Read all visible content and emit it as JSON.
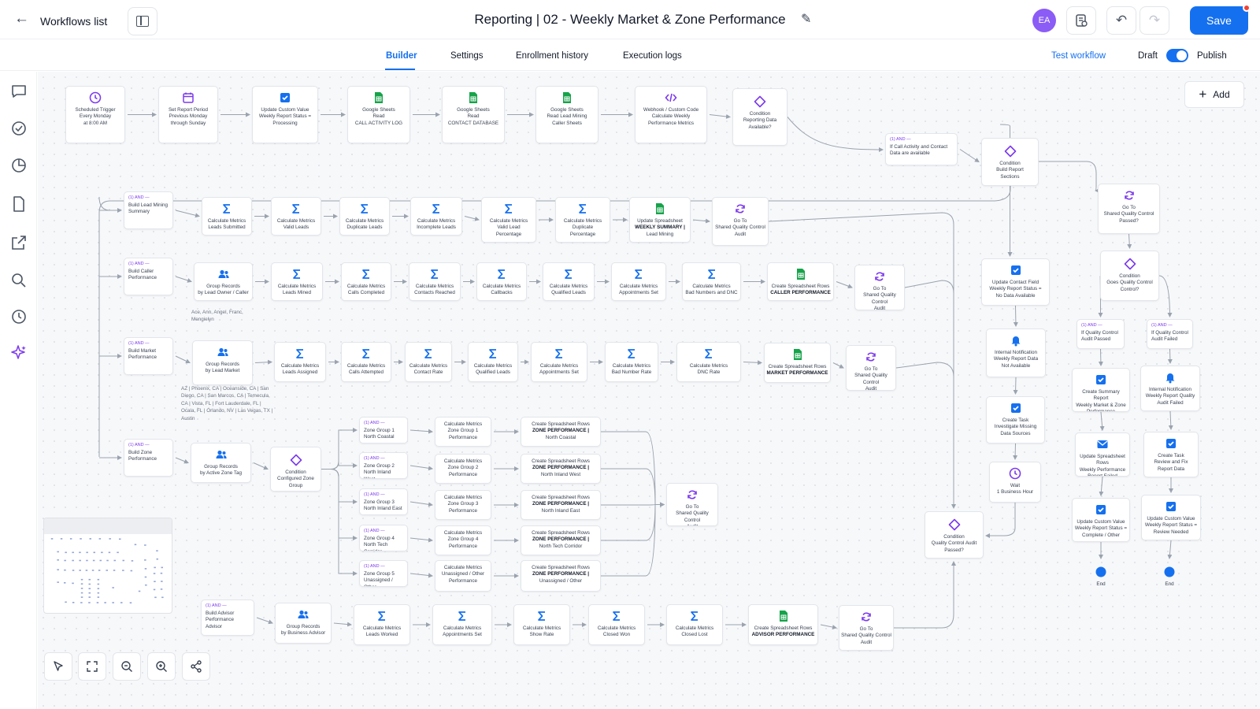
{
  "header": {
    "back_label": "Workflows list",
    "title": "Reporting | 02 - Weekly Market & Zone Performance",
    "avatar": "EA",
    "save_label": "Save"
  },
  "tabs": {
    "items": [
      "Builder",
      "Settings",
      "Enrollment history",
      "Execution logs"
    ],
    "active": "Builder",
    "test_label": "Test workflow",
    "draft_label": "Draft",
    "publish_label": "Publish",
    "published": true
  },
  "toolbar": {
    "add_label": "Add"
  },
  "colors": {
    "accent": "#1570ef",
    "sheets": "#16a34a",
    "condition": "#7c3aed",
    "clock": "#7c3aed"
  },
  "notes": {
    "caller": "Ace, Ann, Angel, Franc, Mengielyn",
    "market": "AZ | Phoenix, CA | Oceanside, CA | San Diego, CA | San Marcos, CA | Temecula, CA | Vista, FL | Fort Lauderdale, FL | Ocala, FL | Orlando, NV | Las Vegas, TX | Austin"
  },
  "nodes": [
    {
      "id": "n1",
      "k": "clock",
      "l1": "Scheduled Trigger",
      "l2": "Every Monday",
      "l3": "at 8:00 AM"
    },
    {
      "id": "n2",
      "k": "cal",
      "l1": "Set Report Period",
      "l2": "Previous Monday",
      "l3": "through Sunday"
    },
    {
      "id": "n3",
      "k": "check",
      "l1": "Update Custom Value",
      "l2": "Weekly Report Status =",
      "l3": "Processing"
    },
    {
      "id": "n4",
      "k": "sheet",
      "l1": "Google Sheets",
      "l2": "Read",
      "l3": "CALL ACTIVITY LOG"
    },
    {
      "id": "n5",
      "k": "sheet",
      "l1": "Google Sheets",
      "l2": "Read",
      "l3": "CONTACT DATABASE"
    },
    {
      "id": "n6",
      "k": "sheet",
      "l1": "Google Sheets",
      "l2": "Read Lead Mining",
      "l3": "Caller Sheets"
    },
    {
      "id": "n7",
      "k": "code",
      "l1": "Webhook / Custom Code",
      "l2": "Calculate Weekly",
      "l3": "Performance Metrics"
    },
    {
      "id": "n8",
      "k": "cond",
      "l1": "Condition",
      "l2": "Reporting Data",
      "l3": "Available?"
    },
    {
      "id": "a0",
      "k": "and",
      "tag": "(1) AND —",
      "l1": "If Call Activity and Contact",
      "l2": "Data are available"
    },
    {
      "id": "c1",
      "k": "cond",
      "l1": "Condition",
      "l2": "Build Report",
      "l3": "Sections"
    },
    {
      "id": "a1",
      "k": "and",
      "tag": "(1) AND —",
      "l1": "Build Lead Mining",
      "l2": "Summary"
    },
    {
      "id": "r1a",
      "k": "sigma",
      "l1": "Calculate Metrics",
      "l2": "Leads Submitted"
    },
    {
      "id": "r1b",
      "k": "sigma",
      "l1": "Calculate Metrics",
      "l2": "Valid Leads"
    },
    {
      "id": "r1c",
      "k": "sigma",
      "l1": "Calculate Metrics",
      "l2": "Duplicate Leads"
    },
    {
      "id": "r1d",
      "k": "sigma",
      "l1": "Calculate Metrics",
      "l2": "Incomplete Leads"
    },
    {
      "id": "r1e",
      "k": "sigma",
      "l1": "Calculate Metrics",
      "l2": "Valid Lead",
      "l3": "Percentage"
    },
    {
      "id": "r1f",
      "k": "sigma",
      "l1": "Calculate Metrics",
      "l2": "Duplicate",
      "l3": "Percentage"
    },
    {
      "id": "r1g",
      "k": "sheet",
      "l1": "Update Spreadsheet",
      "l2": "WEEKLY SUMMARY |",
      "l3": "Lead Mining",
      "bold": "l2"
    },
    {
      "id": "r1h",
      "k": "goto",
      "l1": "Go To",
      "l2": "Shared Quality Control",
      "l3": "Audit"
    },
    {
      "id": "a2",
      "k": "and",
      "tag": "(1) AND —",
      "l1": "Build Caller",
      "l2": "Performance"
    },
    {
      "id": "r2a",
      "k": "group",
      "l1": "Group Records",
      "l2": "by Lead Owner / Caller"
    },
    {
      "id": "r2b",
      "k": "sigma",
      "l1": "Calculate Metrics",
      "l2": "Leads Mined"
    },
    {
      "id": "r2c",
      "k": "sigma",
      "l1": "Calculate Metrics",
      "l2": "Calls Completed"
    },
    {
      "id": "r2d",
      "k": "sigma",
      "l1": "Calculate Metrics",
      "l2": "Contacts Reached"
    },
    {
      "id": "r2e",
      "k": "sigma",
      "l1": "Calculate Metrics",
      "l2": "Callbacks"
    },
    {
      "id": "r2f",
      "k": "sigma",
      "l1": "Calculate Metrics",
      "l2": "Qualified Leads"
    },
    {
      "id": "r2g",
      "k": "sigma",
      "l1": "Calculate Metrics",
      "l2": "Appointments Set"
    },
    {
      "id": "r2h",
      "k": "sigma",
      "l1": "Calculate Metrics",
      "l2": "Bad Numbers and DNC"
    },
    {
      "id": "r2i",
      "k": "sheet",
      "l1": "Create Spreadsheet Rows",
      "l2": "CALLER PERFORMANCE",
      "bold": "l2"
    },
    {
      "id": "r2j",
      "k": "goto",
      "l1": "Go To",
      "l2": "Shared Quality Control",
      "l3": "Audit"
    },
    {
      "id": "a3",
      "k": "and",
      "tag": "(1) AND —",
      "l1": "Build Market",
      "l2": "Performance"
    },
    {
      "id": "r3a",
      "k": "group",
      "l1": "Group Records",
      "l2": "by Lead Market"
    },
    {
      "id": "r3b",
      "k": "sigma",
      "l1": "Calculate Metrics",
      "l2": "Leads Assigned"
    },
    {
      "id": "r3c",
      "k": "sigma",
      "l1": "Calculate Metrics",
      "l2": "Calls Attempted"
    },
    {
      "id": "r3d",
      "k": "sigma",
      "l1": "Calculate Metrics",
      "l2": "Contact Rate"
    },
    {
      "id": "r3e",
      "k": "sigma",
      "l1": "Calculate Metrics",
      "l2": "Qualified Leads"
    },
    {
      "id": "r3f",
      "k": "sigma",
      "l1": "Calculate Metrics",
      "l2": "Appointments Set"
    },
    {
      "id": "r3g",
      "k": "sigma",
      "l1": "Calculate Metrics",
      "l2": "Bad Number Rate"
    },
    {
      "id": "r3h",
      "k": "sigma",
      "l1": "Calculate Metrics",
      "l2": "DNC Rate"
    },
    {
      "id": "r3i",
      "k": "sheet",
      "l1": "Create Spreadsheet Rows",
      "l2": "MARKET PERFORMANCE",
      "bold": "l2"
    },
    {
      "id": "r3j",
      "k": "goto",
      "l1": "Go To",
      "l2": "Shared Quality Control",
      "l3": "Audit"
    },
    {
      "id": "a4",
      "k": "and",
      "tag": "(1) AND —",
      "l1": "Build Zone",
      "l2": "Performance"
    },
    {
      "id": "r4a",
      "k": "group",
      "l1": "Group Records",
      "l2": "by Active Zone Tag"
    },
    {
      "id": "r4b",
      "k": "cond",
      "l1": "Condition",
      "l2": "Configured Zone",
      "l3": "Group"
    },
    {
      "id": "z1",
      "k": "and",
      "tag": "(1) AND —",
      "l1": "Zone Group 1",
      "l2": "North Coastal"
    },
    {
      "id": "z2",
      "k": "and",
      "tag": "(1) AND —",
      "l1": "Zone Group 2",
      "l2": "North Inland West"
    },
    {
      "id": "z3",
      "k": "and",
      "tag": "(1) AND —",
      "l1": "Zone Group 3",
      "l2": "North Inland East"
    },
    {
      "id": "z4",
      "k": "and",
      "tag": "(1) AND —",
      "l1": "Zone Group 4",
      "l2": "North Tech Corridor"
    },
    {
      "id": "z5",
      "k": "and",
      "tag": "(1) AND —",
      "l1": "Zone Group 5",
      "l2": "Unassigned / Other"
    },
    {
      "id": "zm1",
      "k": "plain",
      "l1": "Calculate Metrics",
      "l2": "Zone Group 1",
      "l3": "Performance"
    },
    {
      "id": "zm2",
      "k": "plain",
      "l1": "Calculate Metrics",
      "l2": "Zone Group 2",
      "l3": "Performance"
    },
    {
      "id": "zm3",
      "k": "plain",
      "l1": "Calculate Metrics",
      "l2": "Zone Group 3",
      "l3": "Performance"
    },
    {
      "id": "zm4",
      "k": "plain",
      "l1": "Calculate Metrics",
      "l2": "Zone Group 4",
      "l3": "Performance"
    },
    {
      "id": "zm5",
      "k": "plain",
      "l1": "Calculate Metrics",
      "l2": "Unassigned / Other",
      "l3": "Performance"
    },
    {
      "id": "zs1",
      "k": "plain",
      "l1": "Create Spreadsheet Rows",
      "l2": "ZONE PERFORMANCE |",
      "l3": "North Coastal",
      "bold": "l2"
    },
    {
      "id": "zs2",
      "k": "plain",
      "l1": "Create Spreadsheet Rows",
      "l2": "ZONE PERFORMANCE |",
      "l3": "North Inland West",
      "bold": "l2"
    },
    {
      "id": "zs3",
      "k": "plain",
      "l1": "Create Spreadsheet Rows",
      "l2": "ZONE PERFORMANCE |",
      "l3": "North Inland East",
      "bold": "l2"
    },
    {
      "id": "zs4",
      "k": "plain",
      "l1": "Create Spreadsheet Rows",
      "l2": "ZONE PERFORMANCE |",
      "l3": "North Tech Corridor",
      "bold": "l2"
    },
    {
      "id": "zs5",
      "k": "plain",
      "l1": "Create Spreadsheet Rows",
      "l2": "ZONE PERFORMANCE |",
      "l3": "Unassigned / Other",
      "bold": "l2"
    },
    {
      "id": "zg",
      "k": "goto",
      "l1": "Go To",
      "l2": "Shared Quality Control",
      "l3": "Audit"
    },
    {
      "id": "a5",
      "k": "and",
      "tag": "(1) AND —",
      "l1": "Build Advisor",
      "l2": "Performance Advisor"
    },
    {
      "id": "r5a",
      "k": "group",
      "l1": "Group Records",
      "l2": "by Business Advisor"
    },
    {
      "id": "r5b",
      "k": "sigma",
      "l1": "Calculate Metrics",
      "l2": "Leads Worked"
    },
    {
      "id": "r5c",
      "k": "sigma",
      "l1": "Calculate Metrics",
      "l2": "Appointments Set"
    },
    {
      "id": "r5d",
      "k": "sigma",
      "l1": "Calculate Metrics",
      "l2": "Show Rate"
    },
    {
      "id": "r5e",
      "k": "sigma",
      "l1": "Calculate Metrics",
      "l2": "Closed Won"
    },
    {
      "id": "r5f",
      "k": "sigma",
      "l1": "Calculate Metrics",
      "l2": "Closed Lost"
    },
    {
      "id": "r5g",
      "k": "sheet",
      "l1": "Create Spreadsheet Rows",
      "l2": "ADVISOR PERFORMANCE",
      "bold": "l2"
    },
    {
      "id": "r5h",
      "k": "goto",
      "l1": "Go To",
      "l2": "Shared Quality Control",
      "l3": "Audit"
    },
    {
      "id": "nd1",
      "k": "check",
      "l1": "Update Contact Field",
      "l2": "Weekly Report Status =",
      "l3": "No Data Available"
    },
    {
      "id": "nd2",
      "k": "bell",
      "l1": "Internal Notification",
      "l2": "Weekly Report Data",
      "l3": "Not Available"
    },
    {
      "id": "nd3",
      "k": "check",
      "l1": "Create Task",
      "l2": "Investigate Missing",
      "l3": "Data Sources"
    },
    {
      "id": "nd4",
      "k": "clock",
      "l1": "Wait",
      "l2": "1 Business Hour"
    },
    {
      "id": "qa",
      "k": "cond",
      "l1": "Condition",
      "l2": "Quality Control Audit",
      "l3": "Passed?"
    },
    {
      "id": "gt",
      "k": "goto",
      "l1": "Go To",
      "l2": "Shared Quality Control",
      "l3": "Passed?"
    },
    {
      "id": "cq",
      "k": "cond",
      "l1": "Condition",
      "l2": "Goes Quality Control",
      "l3": "Control?"
    },
    {
      "id": "qp",
      "k": "and",
      "tag": "(1) AND —",
      "l1": "If Quality Control",
      "l2": "Audit Passed"
    },
    {
      "id": "qf",
      "k": "and",
      "tag": "(1) AND —",
      "l1": "If Quality Control",
      "l2": "Audit Failed"
    },
    {
      "id": "p1",
      "k": "check",
      "l1": "Create Summary Report",
      "l2": "Weekly Market & Zone",
      "l3": "Performance"
    },
    {
      "id": "p2",
      "k": "mail",
      "l1": "Update Spreadsheet Rows",
      "l2": "Weekly Performance",
      "l3": "Report Failed"
    },
    {
      "id": "p3",
      "k": "check",
      "l1": "Update Custom Value",
      "l2": "Weekly Report Status =",
      "l3": "Complete / Other"
    },
    {
      "id": "pe",
      "k": "end",
      "l1": "End"
    },
    {
      "id": "f1",
      "k": "bell",
      "l1": "Internal Notification",
      "l2": "Weekly Report Quality",
      "l3": "Audit Failed"
    },
    {
      "id": "f2",
      "k": "check",
      "l1": "Create Task",
      "l2": "Review and Fix",
      "l3": "Report Data"
    },
    {
      "id": "f3",
      "k": "check",
      "l1": "Update Custom Value",
      "l2": "Weekly Report Status =",
      "l3": "Review Needed"
    },
    {
      "id": "fe",
      "k": "end",
      "l1": "End"
    }
  ]
}
